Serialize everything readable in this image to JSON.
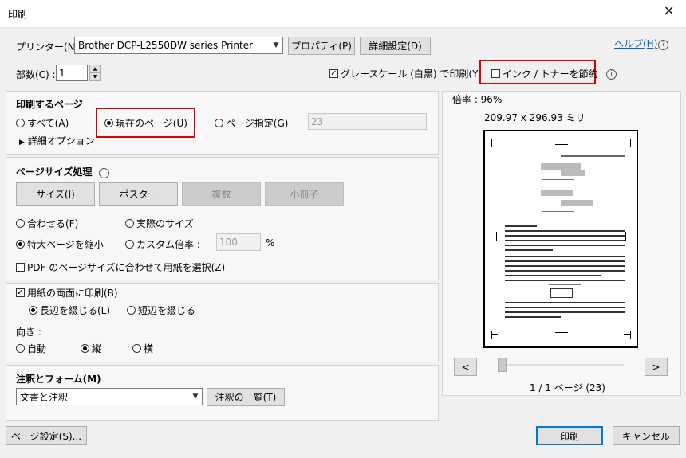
{
  "window": {
    "title": "印刷",
    "close_glyph": "✕"
  },
  "printer": {
    "label": "プリンター(N) :",
    "selected": "Brother DCP-L2550DW series Printer",
    "properties_button": "プロパティ(P)",
    "advanced_button": "詳細設定(D)",
    "help_link": "ヘルプ(H)"
  },
  "copies": {
    "label": "部数(C) :",
    "value": "1"
  },
  "options": {
    "grayscale_label": "グレースケール (白黒) で印刷(Y)",
    "grayscale_checked": true,
    "save_ink_label": "インク / トナーを節約",
    "save_ink_checked": false
  },
  "pages_to_print": {
    "title": "印刷するページ",
    "all_label": "すべて(A)",
    "current_label": "現在のページ(U)",
    "range_label": "ページ指定(G)",
    "range_value": "23",
    "more_options": "詳細オプション",
    "selected": "current"
  },
  "page_sizing": {
    "title": "ページサイズ処理",
    "buttons": {
      "size": "サイズ(I)",
      "poster": "ポスター",
      "multiple": "複数",
      "booklet": "小冊子"
    },
    "fit_label": "合わせる(F)",
    "actual_label": "実際のサイズ",
    "shrink_label": "特大ページを縮小",
    "custom_label": "カスタム倍率 :",
    "custom_value": "100",
    "percent": "%",
    "pdf_size_label": "PDF のページサイズに合わせて用紙を選択(Z)"
  },
  "duplex": {
    "label": "用紙の両面に印刷(B)",
    "long_edge": "長辺を綴じる(L)",
    "short_edge": "短辺を綴じる"
  },
  "orientation": {
    "label": "向き :",
    "auto": "自動",
    "portrait": "縦",
    "landscape": "横"
  },
  "comments": {
    "title": "注釈とフォーム(M)",
    "selected": "文書と注釈",
    "summary_button": "注釈の一覧(T)"
  },
  "preview": {
    "scale": "倍率 : 96%",
    "dimensions": "209.97 x 296.93 ミリ",
    "prev": "<",
    "next": ">",
    "page_info": "1 / 1 ページ (23)"
  },
  "footer": {
    "page_setup": "ページ設定(S)...",
    "print": "印刷",
    "cancel": "キャンセル"
  }
}
